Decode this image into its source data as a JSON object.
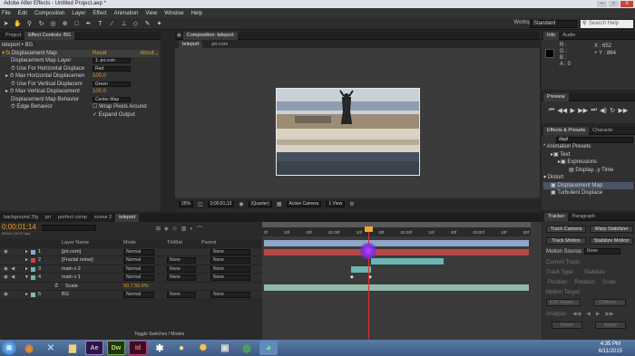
{
  "window": {
    "title": "Adobe After Effects - Untitled Project.aep *",
    "controls": [
      "—",
      "□",
      "X"
    ]
  },
  "menu": [
    "File",
    "Edit",
    "Composition",
    "Layer",
    "Effect",
    "Animation",
    "View",
    "Window",
    "Help"
  ],
  "toolbar": {
    "workspace_label": "Workspace:",
    "workspace_value": "Standard",
    "search_placeholder": "Search Help"
  },
  "left_panel": {
    "tabs": [
      "Project",
      "Effect Controls: BG"
    ],
    "breadcrumb": "teleport • BG",
    "effect_name": "Displacement Map",
    "reset_label": "Reset",
    "about_label": "About...",
    "props": [
      {
        "label": "Displacement Map Layer",
        "value": "1. pri.com",
        "kind": "dropdown"
      },
      {
        "label": "Use For Horizontal Displace",
        "value": "Red",
        "kind": "dropdown"
      },
      {
        "label": "Max Horizontal Displacemen",
        "value": "100.0",
        "kind": "number"
      },
      {
        "label": "Use For Vertical Displacem",
        "value": "Green",
        "kind": "dropdown"
      },
      {
        "label": "Max Vertical Displacement",
        "value": "100.0",
        "kind": "number"
      },
      {
        "label": "Displacement Map Behavior",
        "value": "Center Map",
        "kind": "dropdown"
      },
      {
        "label": "Edge Behavior",
        "value": "Wrap Pixels Around",
        "kind": "check"
      },
      {
        "label": "",
        "value": "Expand Output",
        "kind": "checked"
      }
    ]
  },
  "comp_panel": {
    "tab_label": "Composition: teleport",
    "subtabs": [
      "teleport",
      "pri.com"
    ],
    "zoom": "25%",
    "timecode": "0;00;01;13",
    "resolution": "(Quarter)",
    "camera": "Active Camera",
    "views": "1 View"
  },
  "info_panel": {
    "tabs": [
      "Info",
      "Audio"
    ],
    "r_label": "R :",
    "g_label": "G :",
    "b_label": "B :",
    "a_label": "A : 0",
    "x_label": "X : 652",
    "y_label": "+ Y : 864"
  },
  "preview_panel": {
    "title": "Preview"
  },
  "effects_panel": {
    "tabs": [
      "Effects & Presets",
      "Characte"
    ],
    "search_value": "displ",
    "tree": [
      {
        "label": "* Animation Presets",
        "indent": 0
      },
      {
        "label": "Text",
        "indent": 1
      },
      {
        "label": "Expressions",
        "indent": 2
      },
      {
        "label": "Display...y Time",
        "indent": 3
      },
      {
        "label": "Distort",
        "indent": 0
      },
      {
        "label": "Displacement Map",
        "indent": 1,
        "selected": true
      },
      {
        "label": "Turbulent Displace",
        "indent": 1
      }
    ]
  },
  "timeline": {
    "tabs": [
      "background 2fg",
      "pri",
      "perfect comp",
      "scene 2",
      "teleport"
    ],
    "timecode": "0;00;01;14",
    "fps_note": "00044 (29.97 fps)",
    "columns": {
      "layer_name": "Layer Name",
      "mode": "Mode",
      "trkmat": "TrkMat",
      "parent": "Parent"
    },
    "ruler": [
      "0f",
      "10f",
      "20f",
      "01:00f",
      "10f",
      "20f",
      "02:00f",
      "10f",
      "20f",
      "03:00f",
      "10f",
      "20f"
    ],
    "layers": [
      {
        "num": "1",
        "name": "[pri.com]",
        "mode": "Normal",
        "trkmat": "",
        "parent": "None",
        "color": "#8fa6c9"
      },
      {
        "num": "2",
        "name": "[Fractal noise]",
        "mode": "Normal",
        "trkmat": "None",
        "parent": "None",
        "color": "#c84545"
      },
      {
        "num": "3",
        "name": "main v 2",
        "mode": "Normal",
        "trkmat": "None",
        "parent": "None",
        "color": "#6bb6b4"
      },
      {
        "num": "4",
        "name": "main v 1",
        "mode": "Normal",
        "trkmat": "None",
        "parent": "None",
        "color": "#6bb6b4"
      },
      {
        "num": "",
        "name": "Scale",
        "mode": "",
        "trkmat": "",
        "parent": "",
        "color": "",
        "value": "50.7,50.6%"
      },
      {
        "num": "5",
        "name": "BG",
        "mode": "Normal",
        "trkmat": "None",
        "parent": "None",
        "color": "#8fb9a9"
      }
    ],
    "footer": "Toggle Switches / Modes"
  },
  "tracker_panel": {
    "tabs": [
      "Tracker",
      "Paragraph"
    ],
    "track_camera": "Track Camera",
    "warp_stabilizer": "Warp Stabilizer",
    "track_motion": "Track Motion",
    "stabilize_motion": "Stabilize Motion",
    "motion_source_label": "Motion Source:",
    "motion_source_value": "None",
    "current_track": "Current Track:",
    "track_type": "Track Type:",
    "track_type_value": "Stabilize",
    "checks": [
      "Position",
      "Rotation",
      "Scale"
    ],
    "motion_target": "Motion Target:",
    "edit_target": "Edit Target...",
    "options": "Options...",
    "analyze": "Analyze:",
    "reset": "Reset",
    "apply": "Apply"
  },
  "taskbar": {
    "apps": [
      "Start",
      "Firefox",
      "Network",
      "Explorer",
      "Ae",
      "Dw",
      "Id",
      "Tool",
      "Idea",
      "Sun",
      "Film",
      "Chrome",
      "Globe"
    ],
    "time": "4:35 PM",
    "date": "6/11/2015"
  }
}
